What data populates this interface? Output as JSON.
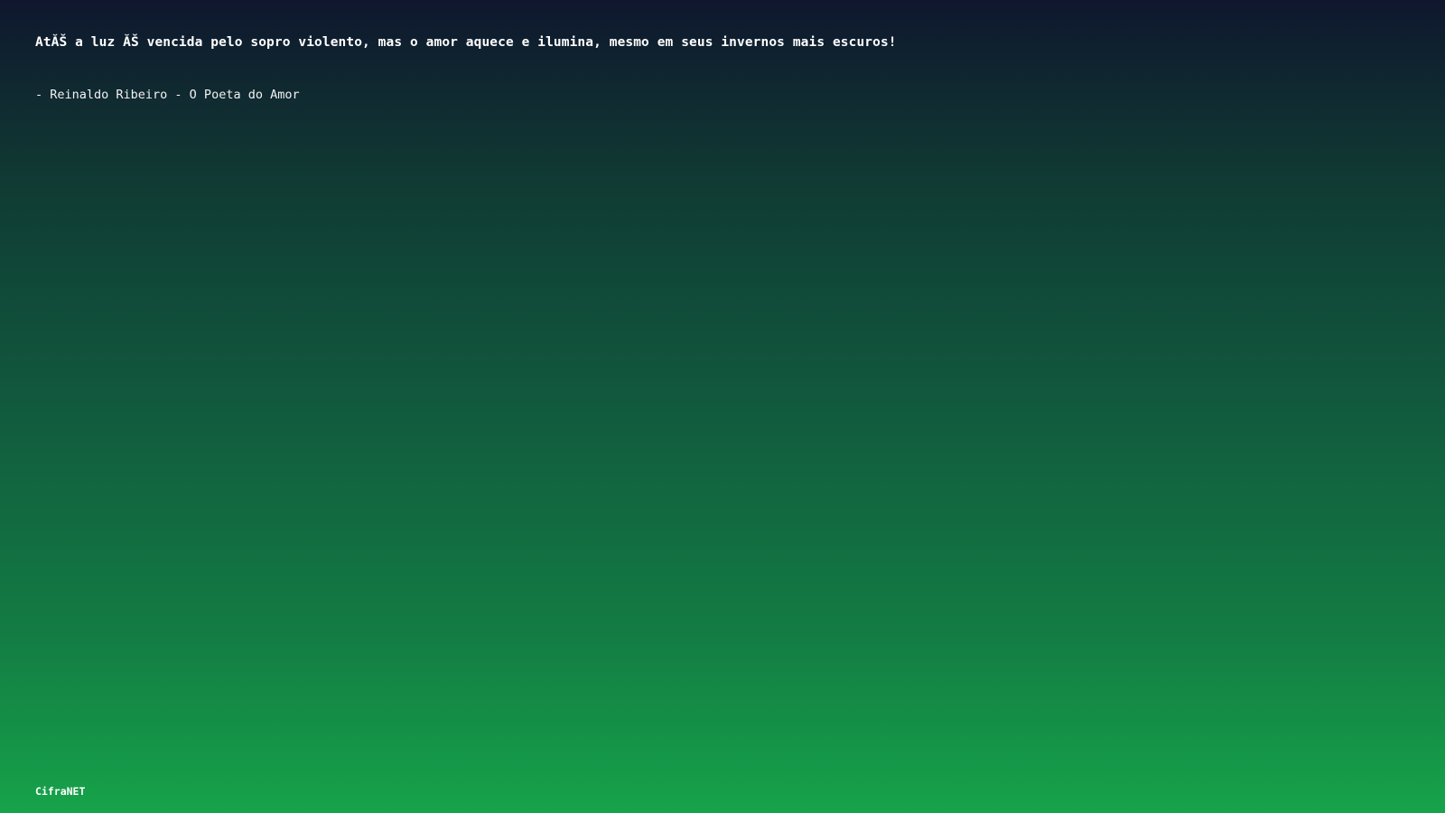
{
  "quote": {
    "text": "AtĂŠ a luz ĂŠ vencida pelo sopro violento, mas o amor aquece e ilumina, mesmo em seus invernos mais escuros!",
    "author": "- Reinaldo Ribeiro - O Poeta do Amor"
  },
  "footer": {
    "brand": "CifraNET"
  },
  "colors": {
    "background_top": "#0f172e",
    "background_bottom": "#16a34a",
    "text": "#ffffff"
  }
}
